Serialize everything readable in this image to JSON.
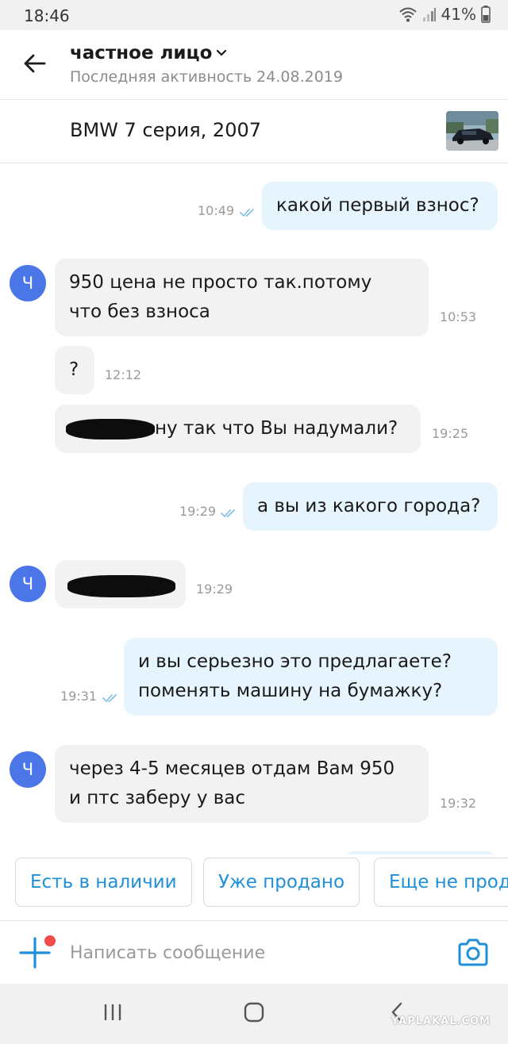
{
  "status_bar": {
    "time": "18:46",
    "battery": "41%"
  },
  "header": {
    "title": "частное лицо",
    "subtitle": "Последняя активность 24.08.2019"
  },
  "listing": {
    "title": "BMW 7 серия, 2007"
  },
  "messages": [
    {
      "direction": "out",
      "lines": [
        "какой первый взнос?"
      ],
      "time": "10:49"
    },
    {
      "direction": "in",
      "avatar": "Ч",
      "lines": [
        "950 цена не просто так.потому",
        "что без взноса"
      ],
      "time": "10:53"
    },
    {
      "direction": "in",
      "lines": [
        "?"
      ],
      "time": "12:12"
    },
    {
      "direction": "in",
      "lines": [
        "ну так что Вы надумали?"
      ],
      "time": "19:25",
      "redacted_prefix": true
    },
    {
      "direction": "out",
      "lines": [
        "а вы из какого города?"
      ],
      "time": "19:29"
    },
    {
      "direction": "in",
      "avatar": "Ч",
      "lines": [],
      "time": "19:29",
      "redacted": true
    },
    {
      "direction": "out",
      "lines": [
        "и вы серьезно это предлагаете?",
        "поменять машину на бумажку?"
      ],
      "time": "19:31"
    },
    {
      "direction": "in",
      "avatar": "Ч",
      "lines": [
        "через 4-5 месяцев отдам Вам 950",
        "и птс заберу у вас"
      ],
      "time": "19:32"
    }
  ],
  "quick_replies": [
    "Есть в наличии",
    "Уже продано",
    "Еще не продано"
  ],
  "composer": {
    "placeholder": "Написать сообщение"
  },
  "watermark": "YAPLAKAL.COM",
  "colors": {
    "accent": "#1e8fd8",
    "outgoing_bubble": "#e6f4fd",
    "incoming_bubble": "#f2f2f2",
    "avatar": "#4a76e8",
    "notification_dot": "#f24a4a"
  },
  "icons": [
    "back-arrow-icon",
    "chevron-down-icon",
    "double-check-icon",
    "plus-icon",
    "camera-icon",
    "wifi-icon",
    "signal-icon",
    "battery-icon",
    "recents-icon",
    "home-icon",
    "back-nav-icon"
  ]
}
